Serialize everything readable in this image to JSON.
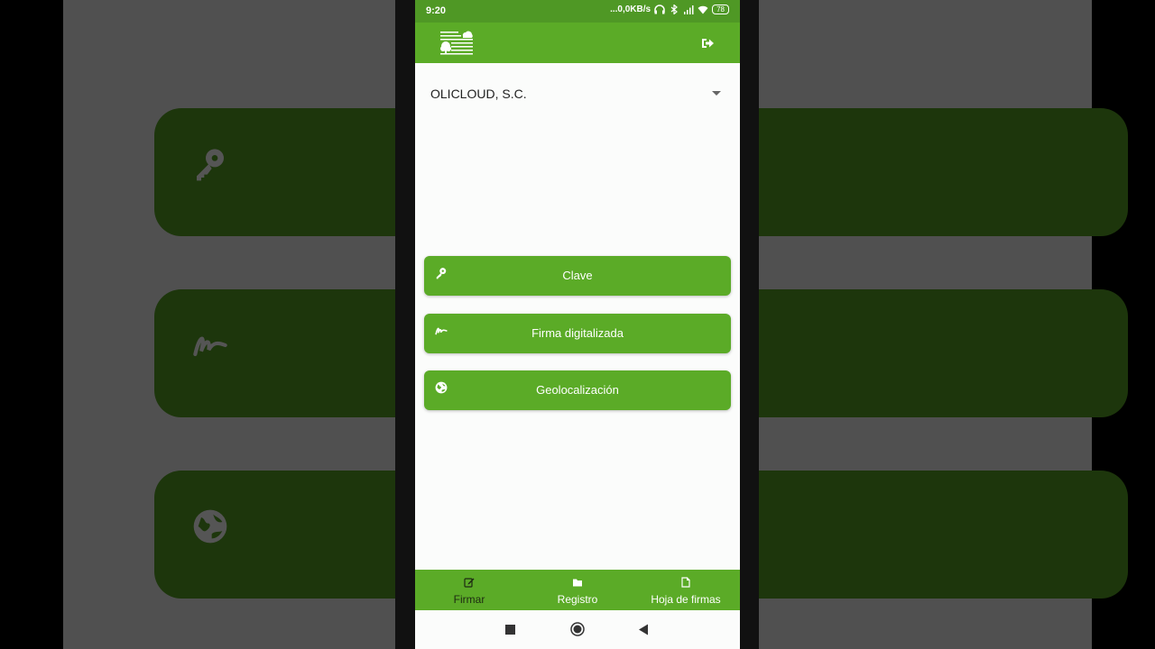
{
  "colors": {
    "primary": "#5bab27",
    "status_bar": "#4f9825",
    "bg_card": "#1d360c",
    "active_nav": "#1d2a12"
  },
  "status_bar": {
    "time": "9:20",
    "network_speed": "...0,0KB/s",
    "icons": [
      "headphones-icon",
      "bluetooth-icon",
      "signal-icon",
      "wifi-icon"
    ],
    "battery": "78"
  },
  "app_bar": {
    "logo": "olicloud-logo",
    "logout_icon": "sign-out-icon"
  },
  "company_select": {
    "value": "OLICLOUD, S.C."
  },
  "actions": [
    {
      "label": "Clave",
      "icon": "key-icon"
    },
    {
      "label": "Firma digitalizada",
      "icon": "signature-icon"
    },
    {
      "label": "Geolocalización",
      "icon": "globe-icon"
    }
  ],
  "bottom_nav": [
    {
      "label": "Firmar",
      "icon": "edit-icon",
      "active": true
    },
    {
      "label": "Registro",
      "icon": "folder-icon",
      "active": false
    },
    {
      "label": "Hoja de firmas",
      "icon": "file-icon",
      "active": false
    }
  ],
  "system_nav": [
    "recents-button",
    "home-button",
    "back-button"
  ]
}
